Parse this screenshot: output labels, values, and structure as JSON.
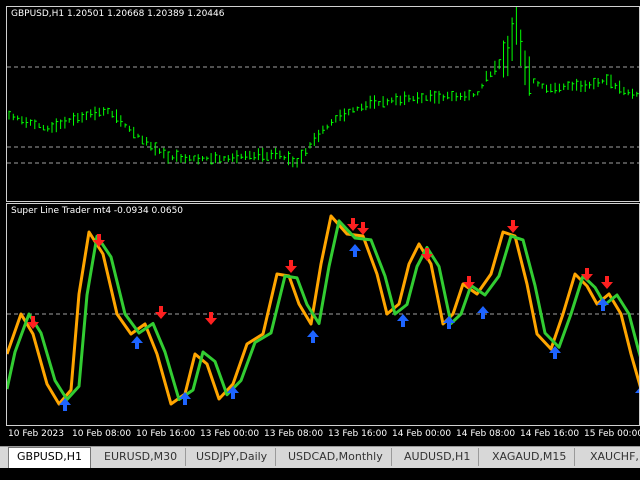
{
  "price_chart": {
    "title": "GBPUSD,H1  1.20501 1.20668 1.20389 1.20446",
    "bar_color": "#00ff00",
    "grid_color": "#a0a0a0"
  },
  "indicator": {
    "title": "Super Line Trader mt4 -0.0934 0.0650",
    "line_colors": {
      "signal": "#ffa500",
      "main": "#32cd32"
    },
    "arrow_colors": {
      "buy": "#1e64ff",
      "sell": "#ff2020"
    }
  },
  "time_axis": [
    "10 Feb 2023",
    "10 Feb 08:00",
    "10 Feb 16:00",
    "13 Feb 00:00",
    "13 Feb 08:00",
    "13 Feb 16:00",
    "14 Feb 00:00",
    "14 Feb 08:00",
    "14 Feb 16:00",
    "15 Feb 00:00",
    "15 Feb 08:00"
  ],
  "tabs": [
    {
      "label": "GBPUSD,H1",
      "active": true
    },
    {
      "label": "EURUSD,M30",
      "active": false
    },
    {
      "label": "USDJPY,Daily",
      "active": false
    },
    {
      "label": "USDCAD,Monthly",
      "active": false
    },
    {
      "label": "AUDUSD,H1",
      "active": false
    },
    {
      "label": "XAGAUD,M15",
      "active": false
    },
    {
      "label": "XAUCHF,",
      "active": false
    }
  ]
}
